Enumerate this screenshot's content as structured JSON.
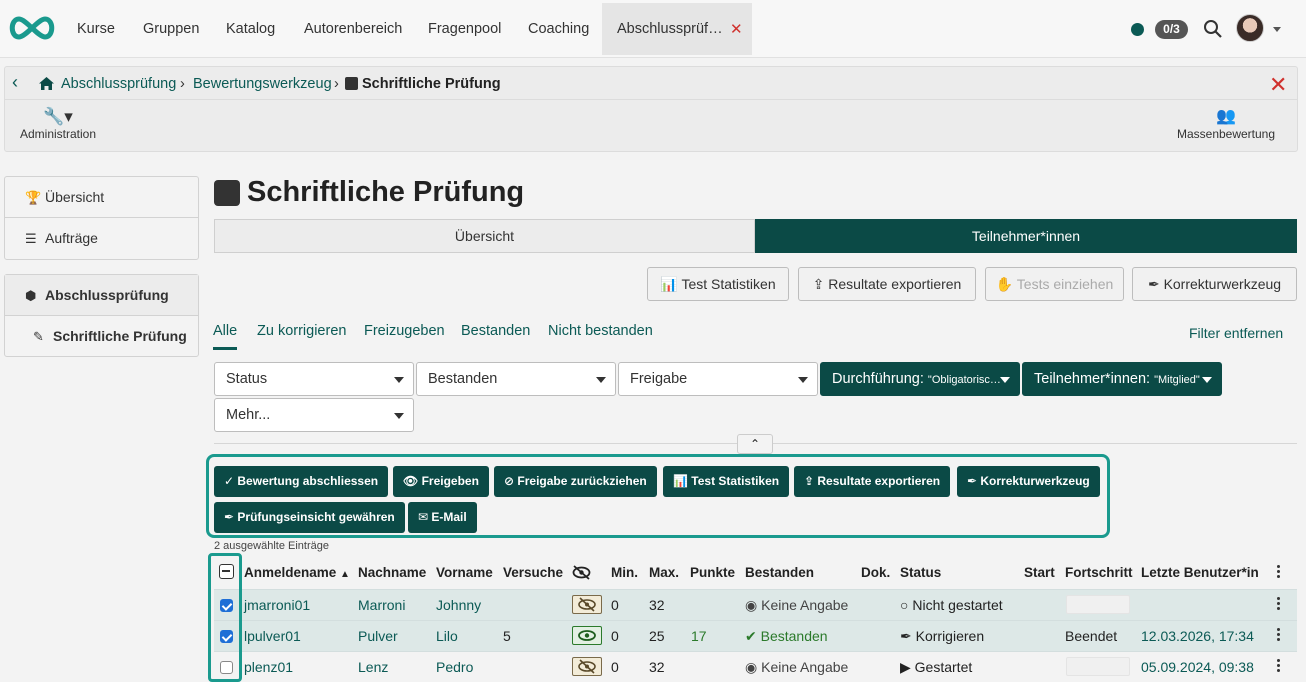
{
  "topnav": {
    "items": [
      "Kurse",
      "Gruppen",
      "Katalog",
      "Autorenbereich",
      "Fragenpool",
      "Coaching"
    ],
    "active_tab": "Abschlussprüf…",
    "active_tab_close": "✕",
    "counter": "0/3"
  },
  "breadcrumb": {
    "back": "‹",
    "items": [
      "Abschlussprüfung",
      "Bewertungswerkzeug",
      "Schriftliche Prüfung"
    ],
    "close": "✕"
  },
  "tools": {
    "administration": "Administration",
    "mass_assessment": "Massenbewertung"
  },
  "sidebar": {
    "group1": [
      "Übersicht",
      "Aufträge"
    ],
    "group2": [
      "Abschlussprüfung",
      "Schriftliche Prüfung"
    ]
  },
  "main": {
    "title": "Schriftliche Prüfung",
    "segments": [
      "Übersicht",
      "Teilnehmer*innen"
    ],
    "actions": [
      "Test Statistiken",
      "Resultate exportieren",
      "Tests einziehen",
      "Korrekturwerkzeug"
    ],
    "tabs": [
      "Alle",
      "Zu korrigieren",
      "Freizugeben",
      "Bestanden",
      "Nicht bestanden"
    ],
    "filter_remove": "Filter entfernen",
    "filters": {
      "status": "Status",
      "bestanden": "Bestanden",
      "freigabe": "Freigabe",
      "durchfuehrung_label": "Durchführung:",
      "durchfuehrung_value": "\"Obligatorisc…",
      "teilnehmer_label": "Teilnehmer*innen:",
      "teilnehmer_value": "\"Mitglied\"",
      "mehr": "Mehr..."
    },
    "bulk_actions": [
      "Bewertung abschliessen",
      "Freigeben",
      "Freigabe zurückziehen",
      "Test Statistiken",
      "Resultate exportieren",
      "Korrekturwerkzeug",
      "Prüfungseinsicht gewähren",
      "E-Mail"
    ],
    "selected_count": "2 ausgewählte Einträge"
  },
  "table": {
    "columns": [
      "Anmeldename",
      "Nachname",
      "Vorname",
      "Versuche",
      "Min.",
      "Max.",
      "Punkte",
      "Bestanden",
      "Dok.",
      "Status",
      "Start",
      "Fortschritt",
      "Letzte Benutzer*in"
    ],
    "rows": [
      {
        "login": "jmarroni01",
        "last": "Marroni",
        "first": "Johnny",
        "attempts": "",
        "min": "0",
        "max": "32",
        "points": "",
        "passed": "Keine Angabe",
        "status": "Nicht gestartet",
        "progress": "",
        "last_user": "",
        "checked": true
      },
      {
        "login": "lpulver01",
        "last": "Pulver",
        "first": "Lilo",
        "attempts": "5",
        "min": "0",
        "max": "25",
        "points": "17",
        "passed": "Bestanden",
        "status": "Korrigieren",
        "progress": "Beendet",
        "last_user": "12.03.2026, 17:34",
        "checked": true
      },
      {
        "login": "plenz01",
        "last": "Lenz",
        "first": "Pedro",
        "attempts": "",
        "min": "0",
        "max": "32",
        "points": "",
        "passed": "Keine Angabe",
        "status": "Gestartet",
        "progress": "",
        "last_user": "05.09.2024, 09:38",
        "checked": false
      }
    ]
  }
}
